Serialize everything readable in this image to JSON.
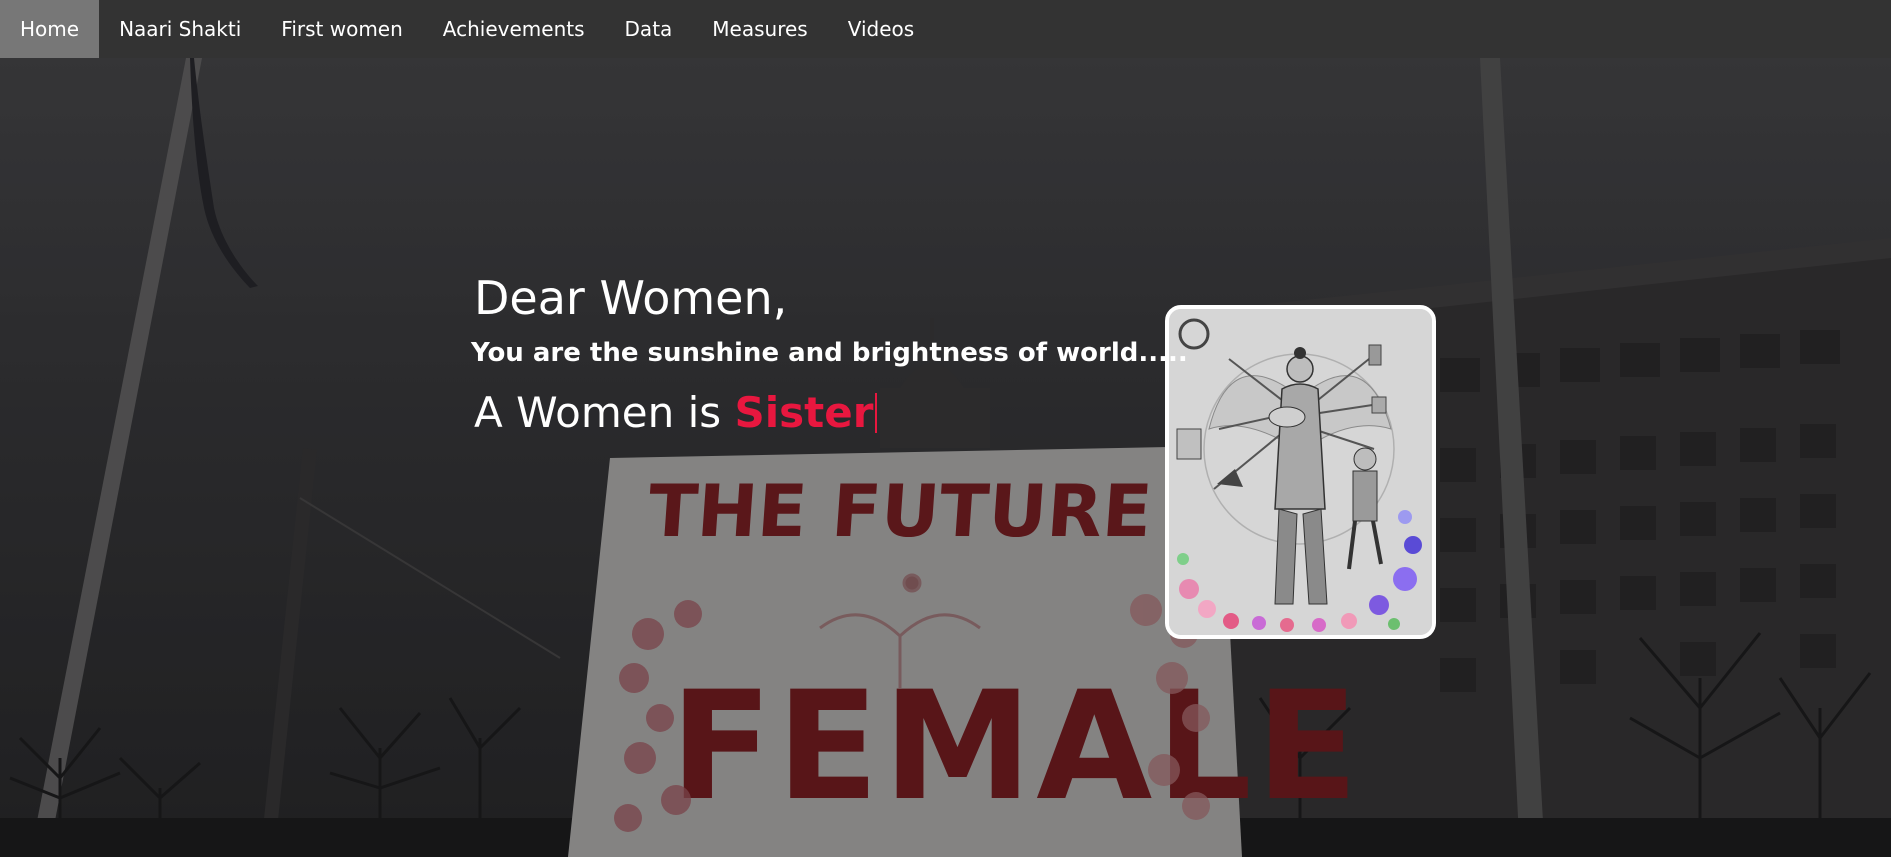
{
  "nav": {
    "items": [
      {
        "label": "Home",
        "active": true
      },
      {
        "label": "Naari Shakti",
        "active": false
      },
      {
        "label": "First women",
        "active": false
      },
      {
        "label": "Achievements",
        "active": false
      },
      {
        "label": "Data",
        "active": false
      },
      {
        "label": "Measures",
        "active": false
      },
      {
        "label": "Videos",
        "active": false
      }
    ]
  },
  "hero": {
    "greeting": "Dear Women,",
    "tagline": "You are the sunshine and brightness of world.....",
    "typing_prefix": "A Women is ",
    "typing_word": "Sister",
    "sign_lines": [
      "THE FUTURE IS",
      "FEMALE"
    ]
  },
  "colors": {
    "nav_bg": "#333333",
    "nav_active_bg": "#777777",
    "accent": "#e8173f",
    "text": "#ffffff"
  }
}
